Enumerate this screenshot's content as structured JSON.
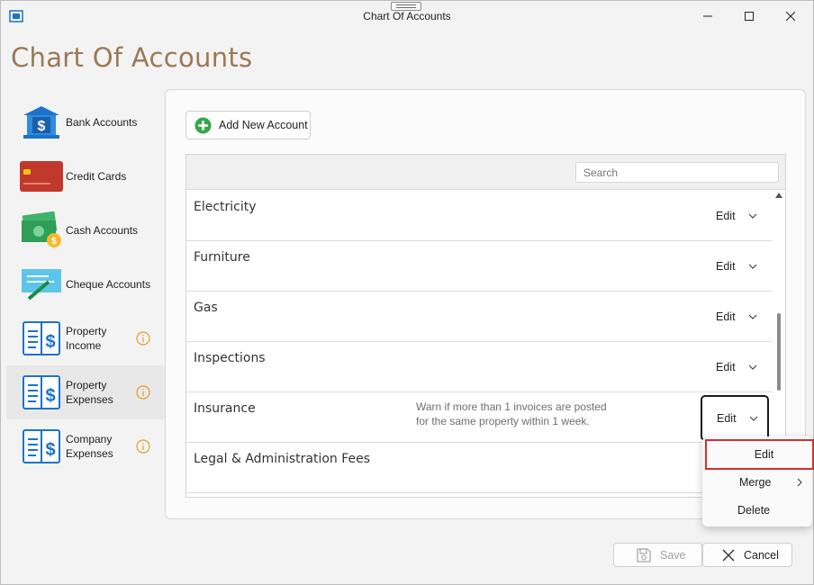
{
  "window": {
    "title": "Chart Of Accounts"
  },
  "page": {
    "title": "Chart Of Accounts"
  },
  "sidebar": {
    "items": [
      {
        "label": "Bank Accounts",
        "icon": "bank-icon",
        "info": false
      },
      {
        "label": "Credit Cards",
        "icon": "credit-card-icon",
        "info": false
      },
      {
        "label": "Cash Accounts",
        "icon": "cash-icon",
        "info": false
      },
      {
        "label": "Cheque Accounts",
        "icon": "cheque-icon",
        "info": false
      },
      {
        "label": "Property\nIncome",
        "icon": "ledger-dollar-icon",
        "info": true
      },
      {
        "label": "Property\nExpenses",
        "icon": "ledger-dollar-icon",
        "info": true,
        "selected": true
      },
      {
        "label": "Company\nExpenses",
        "icon": "ledger-dollar-icon",
        "info": true
      }
    ]
  },
  "toolbar": {
    "add_label": "Add New Account"
  },
  "grid": {
    "search_placeholder": "Search",
    "edit_label": "Edit",
    "rows": [
      {
        "name": "Electricity",
        "note": ""
      },
      {
        "name": "Furniture",
        "note": ""
      },
      {
        "name": "Gas",
        "note": ""
      },
      {
        "name": "Inspections",
        "note": ""
      },
      {
        "name": "Insurance",
        "note": "Warn if more than 1 invoices are posted\nfor the same property within 1 week."
      },
      {
        "name": "Legal & Administration Fees",
        "note": ""
      }
    ]
  },
  "context_menu": {
    "items": [
      "Edit",
      "Merge",
      "Delete"
    ]
  },
  "footer": {
    "save_label": "Save",
    "cancel_label": "Cancel"
  },
  "colors": {
    "title": "#9a7a56",
    "accent_green": "#3aa64a",
    "info_orange": "#e59b2b",
    "icon_blue": "#1b73c9",
    "highlight_red": "#d32f2f"
  }
}
